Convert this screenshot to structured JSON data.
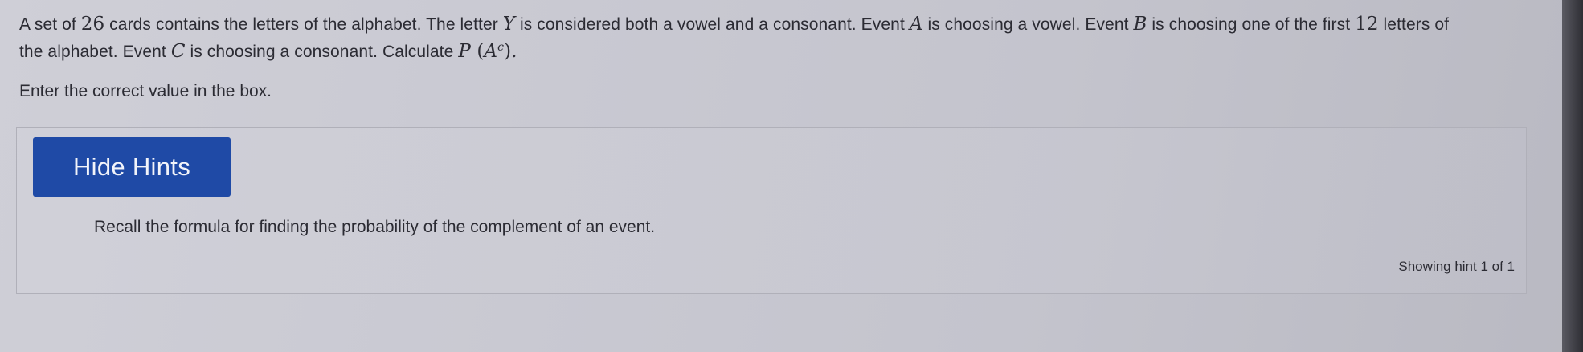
{
  "problem": {
    "line1": {
      "t1": "A set of ",
      "n26": "26",
      "t2": " cards contains the letters of the alphabet. The letter ",
      "varY": "Y",
      "t3": " is considered both a vowel and a consonant. Event ",
      "varA": "A",
      "t4": " is choosing a vowel. Event ",
      "varB": "B",
      "t5": " is choosing one of the first ",
      "n12": "12",
      "t6": " letters of"
    },
    "line2": {
      "t1": "the alphabet. Event ",
      "varC": "C",
      "t2": " is choosing a consonant. Calculate ",
      "expr_P": "P",
      "expr_open": " (",
      "expr_A": "A",
      "expr_c": "c",
      "expr_close": ").",
      "t3": ""
    }
  },
  "instruction": "Enter the correct value in the box.",
  "hints": {
    "button_label": "Hide Hints",
    "hint_text": "Recall the formula for finding the probability of the complement of an event.",
    "counter": "Showing hint 1 of 1"
  }
}
